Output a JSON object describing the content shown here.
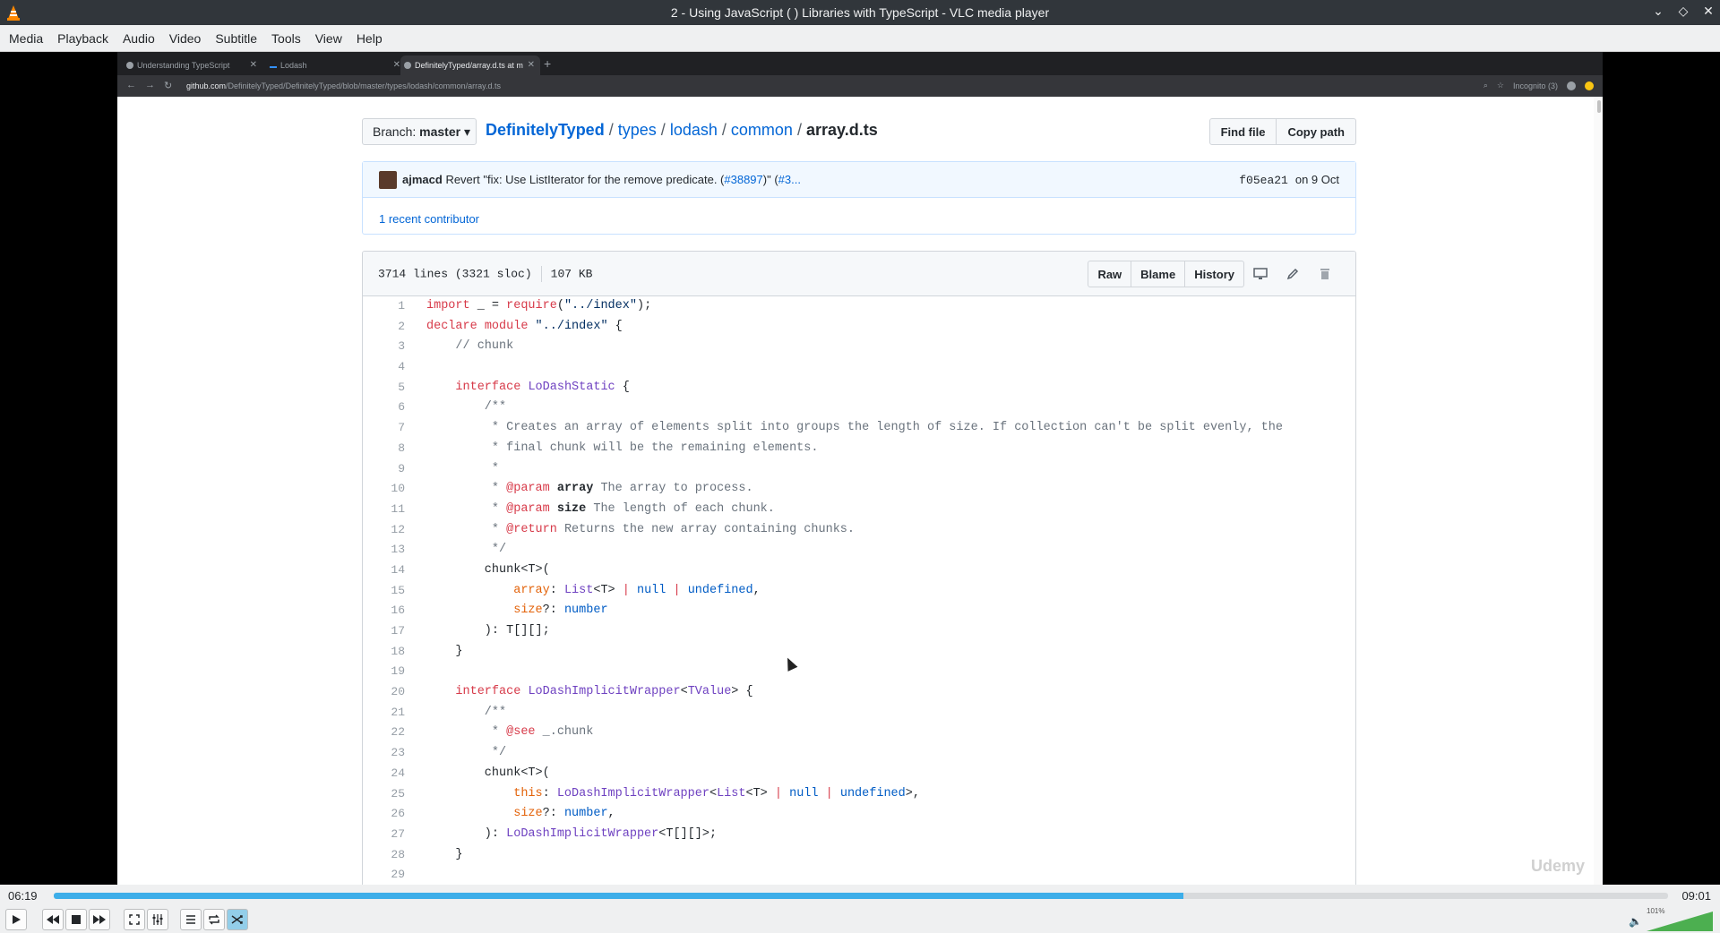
{
  "window": {
    "title": "2 - Using JavaScript ( ) Libraries with TypeScript - VLC media player",
    "controls": [
      "⌄",
      "◇",
      "✕"
    ]
  },
  "menu": [
    "Media",
    "Playback",
    "Audio",
    "Video",
    "Subtitle",
    "Tools",
    "View",
    "Help"
  ],
  "browser": {
    "tabs": [
      {
        "label": "Understanding TypeScript"
      },
      {
        "label": "Lodash"
      },
      {
        "label": "DefinitelyTyped/array.d.ts at m"
      }
    ],
    "url_host": "github.com",
    "url_path": "/DefinitelyTyped/DefinitelyTyped/blob/master/types/lodash/common/array.d.ts",
    "incognito": "Incognito (3)"
  },
  "github": {
    "branch_prefix": "Branch:",
    "branch": "master",
    "crumbs": {
      "repo": "DefinitelyTyped",
      "p1": "types",
      "p2": "lodash",
      "p3": "common",
      "file": "array.d.ts",
      "sep": "/"
    },
    "find_file": "Find file",
    "copy_path": "Copy path",
    "commit": {
      "author": "ajmacd",
      "message": "Revert \"fix: Use ListIterator for the remove predicate. (",
      "pr": "#38897",
      "message_end": ")\" (",
      "pr2": "#3...",
      "sha": "f05ea21",
      "date": "on 9 Oct"
    },
    "contributors": "1 recent contributor",
    "file_info": {
      "lines": "3714 lines (3321 sloc)",
      "size": "107 KB"
    },
    "actions": {
      "raw": "Raw",
      "blame": "Blame",
      "history": "History"
    }
  },
  "code_lines": [
    "import _ = require(\"../index\");",
    "declare module \"../index\" {",
    "    // chunk",
    "",
    "    interface LoDashStatic {",
    "        /**",
    "         * Creates an array of elements split into groups the length of size. If collection can't be split evenly, the",
    "         * final chunk will be the remaining elements.",
    "         *",
    "         * @param array The array to process.",
    "         * @param size The length of each chunk.",
    "         * @return Returns the new array containing chunks.",
    "         */",
    "        chunk<T>(",
    "            array: List<T> | null | undefined,",
    "            size?: number",
    "        ): T[][];",
    "    }",
    "",
    "    interface LoDashImplicitWrapper<TValue> {",
    "        /**",
    "         * @see _.chunk",
    "         */",
    "        chunk<T>(",
    "            this: LoDashImplicitWrapper<List<T> | null | undefined>,",
    "            size?: number,",
    "        ): LoDashImplicitWrapper<T[][]>;",
    "    }",
    ""
  ],
  "watermark": "Udemy",
  "player": {
    "elapsed": "06:19",
    "total": "09:01",
    "progress": 0.7,
    "volume": "101%"
  }
}
